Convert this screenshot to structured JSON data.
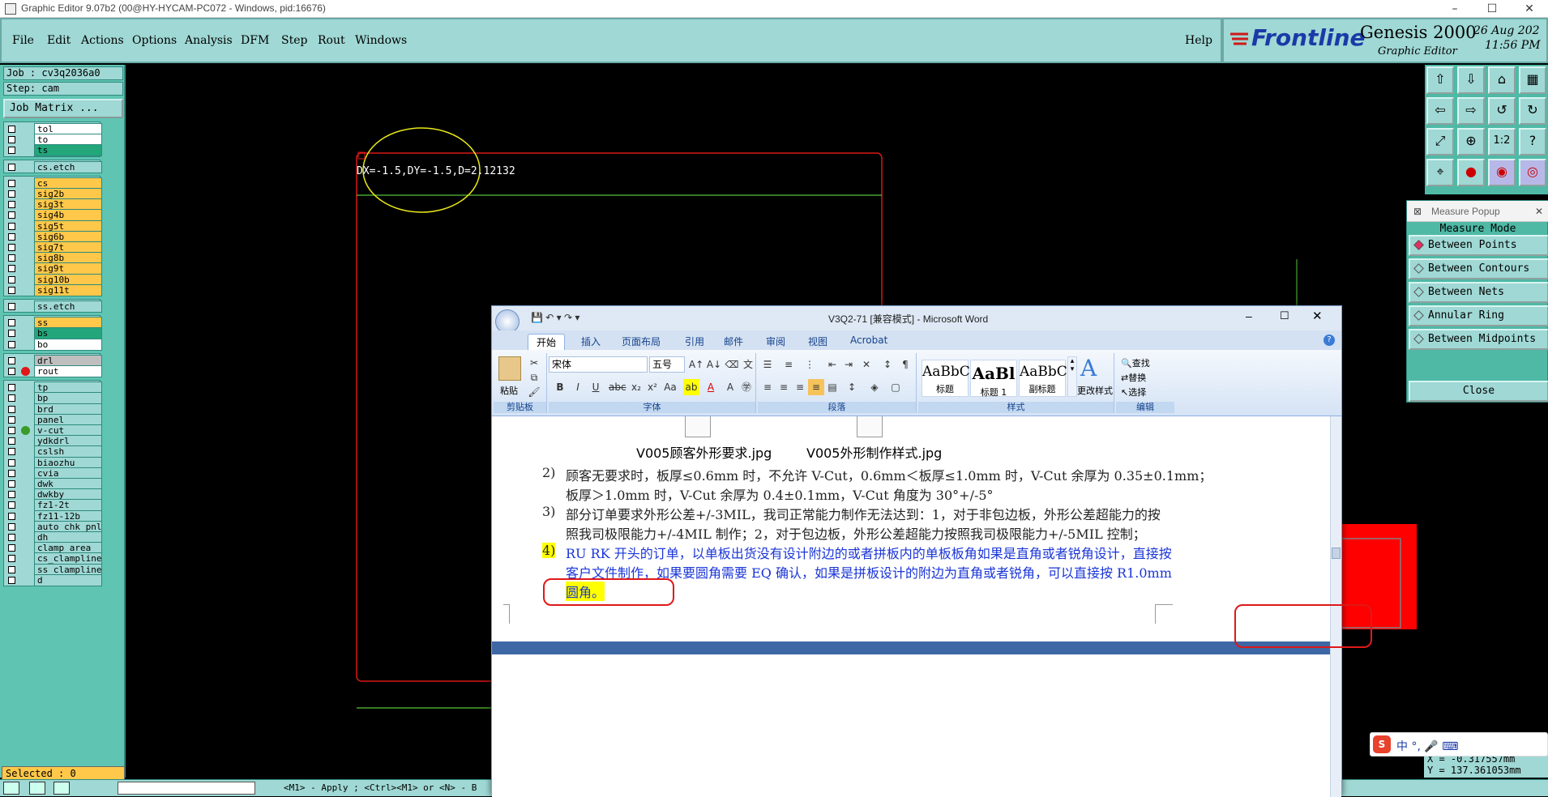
{
  "os_title": "Graphic Editor 9.07b2 (00@HY-HYCAM-PC072 - Windows, pid:16676)",
  "menu": [
    "File",
    "Edit",
    "Actions",
    "Options",
    "Analysis",
    "DFM",
    "Step",
    "Rout",
    "Windows"
  ],
  "help": "Help",
  "logo": {
    "brand": "Frontline",
    "product": "Genesis 2000",
    "subtitle": "Graphic Editor",
    "date": "26 Aug 202",
    "time": "11:56 PM"
  },
  "job_info": {
    "job": "Job : cv3q2036a0",
    "step": "Step: cam",
    "job_matrix": "Job Matrix ..."
  },
  "layer_groups": [
    [
      {
        "name": "tol",
        "color": "white"
      },
      {
        "name": "to",
        "color": "white"
      },
      {
        "name": "ts",
        "color": "green"
      }
    ],
    [
      {
        "name": "cs.etch",
        "color": "teal"
      }
    ],
    [
      {
        "name": "cs",
        "color": "orange"
      },
      {
        "name": "sig2b",
        "color": "orange"
      },
      {
        "name": "sig3t",
        "color": "orange"
      },
      {
        "name": "sig4b",
        "color": "orange"
      },
      {
        "name": "sig5t",
        "color": "orange"
      },
      {
        "name": "sig6b",
        "color": "orange"
      },
      {
        "name": "sig7t",
        "color": "orange"
      },
      {
        "name": "sig8b",
        "color": "orange"
      },
      {
        "name": "sig9t",
        "color": "orange"
      },
      {
        "name": "sig10b",
        "color": "orange"
      },
      {
        "name": "sig11t",
        "color": "orange"
      }
    ],
    [
      {
        "name": "ss.etch",
        "color": "teal"
      }
    ],
    [
      {
        "name": "ss",
        "color": "orange"
      },
      {
        "name": "bs",
        "color": "green"
      },
      {
        "name": "bo",
        "color": "white"
      }
    ],
    [
      {
        "name": "drl",
        "color": "gray"
      },
      {
        "name": "rout",
        "color": "white"
      }
    ],
    [
      {
        "name": "tp",
        "color": "teal"
      },
      {
        "name": "bp",
        "color": "teal"
      },
      {
        "name": "brd",
        "color": "teal"
      },
      {
        "name": "panel",
        "color": "teal"
      },
      {
        "name": "v-cut",
        "color": "teal"
      },
      {
        "name": "ydkdrl",
        "color": "teal"
      },
      {
        "name": "cslsh",
        "color": "teal"
      },
      {
        "name": "biaozhu",
        "color": "teal"
      },
      {
        "name": "cvia",
        "color": "teal"
      },
      {
        "name": "dwk",
        "color": "teal"
      },
      {
        "name": "dwkby",
        "color": "teal"
      },
      {
        "name": "fz1-2t",
        "color": "teal"
      },
      {
        "name": "fz11-12b",
        "color": "teal"
      },
      {
        "name": "auto_chk_pnl",
        "color": "teal"
      },
      {
        "name": "dh",
        "color": "teal"
      },
      {
        "name": "clamp_area",
        "color": "teal"
      },
      {
        "name": "cs_clampline",
        "color": "teal"
      },
      {
        "name": "ss_clampline",
        "color": "teal"
      },
      {
        "name": "d",
        "color": "teal"
      }
    ]
  ],
  "selected": "Selected : 0",
  "measure_readout": "DX=-1.5,DY=-1.5,D=2.12132",
  "measure_popup": {
    "title": "Measure Popup",
    "mode_label": "Measure Mode",
    "modes": [
      "Between Points",
      "Between Contours",
      "Between Nets",
      "Annular Ring",
      "Between Midpoints"
    ],
    "active_mode": "Between Points",
    "close": "Close"
  },
  "coords": {
    "x": "X = -0.317557mm",
    "y": "Y = 137.361053mm"
  },
  "status_hint": "<M1> - Apply  ; <Ctrl><M1> or <N> - B",
  "word": {
    "title": "V3Q2-71 [兼容模式] - Microsoft Word",
    "tabs": [
      "开始",
      "插入",
      "页面布局",
      "引用",
      "邮件",
      "审阅",
      "视图",
      "Acrobat"
    ],
    "active_tab": "开始",
    "font_name": "宋体",
    "font_size": "五号",
    "groups": {
      "clipboard": "剪贴板",
      "paste": "粘贴",
      "font": "字体",
      "paragraph": "段落",
      "styles": "样式",
      "editing": "编辑"
    },
    "styles": [
      {
        "sample": "AaBbC",
        "label": "标题"
      },
      {
        "sample": "AaBl",
        "label": "标题 1"
      },
      {
        "sample": "AaBbC",
        "label": "副标题"
      }
    ],
    "change_styles": "更改样式",
    "edit_items": [
      "查找",
      "替换",
      "选择"
    ],
    "images": [
      "V005顾客外形要求.jpg",
      "V005外形制作样式.jpg"
    ],
    "paragraphs": [
      {
        "num": "2)",
        "lines": [
          "顾客无要求时，板厚≤0.6mm 时，不允许 V-Cut，0.6mm＜板厚≤1.0mm 时，V-Cut 余厚为 0.35±0.1mm；",
          "板厚＞1.0mm 时，V-Cut 余厚为 0.4±0.1mm，V-Cut 角度为 30°+/-5°"
        ]
      },
      {
        "num": "3)",
        "lines": [
          "部分订单要求外形公差+/-3MIL，我司正常能力制作无法达到：1，对于非包边板，外形公差超能力的按",
          "照我司极限能力+/-4MIL 制作；2，对于包边板，外形公差超能力按照我司极限能力+/-5MIL 控制；"
        ]
      },
      {
        "num": "4)",
        "lines": [
          "RU RK 开头的订单，以单板出货没有设计附边的或者拼板内的单板板角如果是直角或者锐角设计，直接按",
          "客户文件制作，如果要圆角需要 EQ 确认，如果是拼板设计的附边为直角或者锐角，可以直接按 R1.0mm",
          "圆角。"
        ]
      }
    ]
  },
  "ime": "中 °, 🎤 ⌨"
}
